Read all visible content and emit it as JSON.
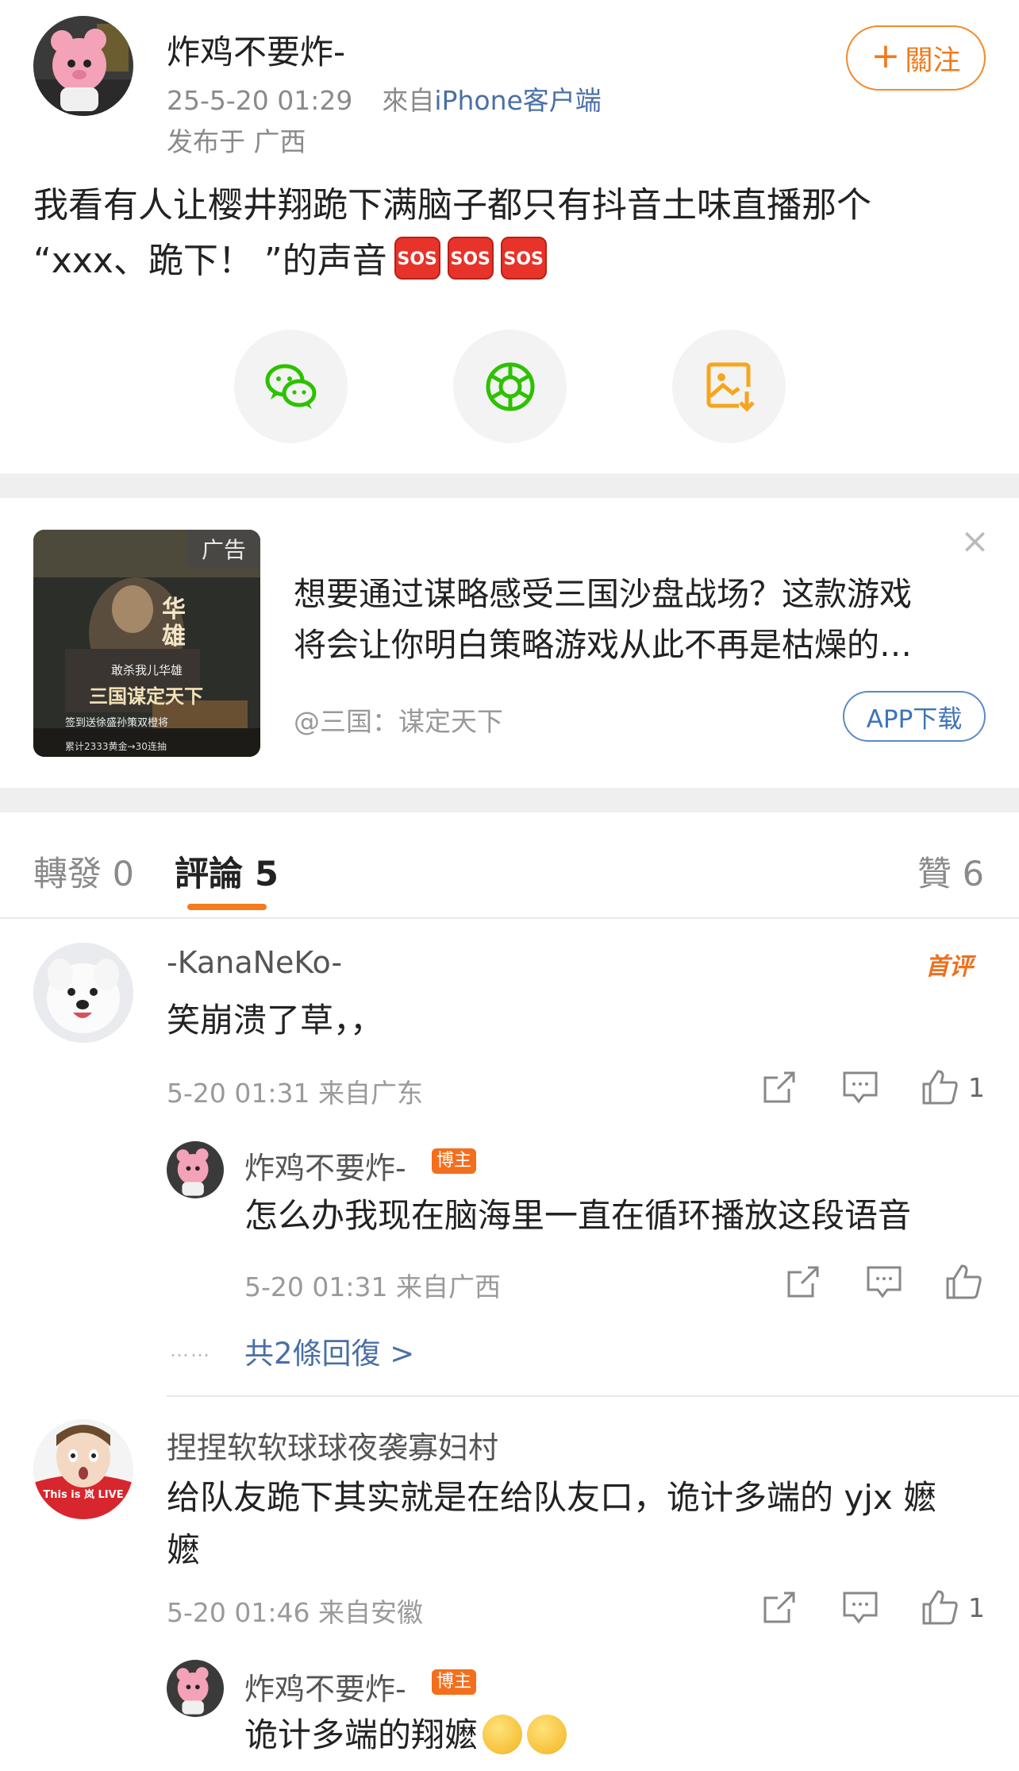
{
  "post": {
    "author": "炸鸡不要炸-",
    "time": "25-5-20 01:29",
    "from_prefix": "來自",
    "source": "iPhone客户端",
    "location": "发布于 广西",
    "follow_label": "關注",
    "text_line1": "我看有人让樱井翔跪下满脑子都只有抖音土味直播那个",
    "text_line2": "“xxx、跪下！ ”的声音",
    "sos_emoji": [
      "SOS",
      "SOS",
      "SOS"
    ],
    "share_icons": [
      "wechat-icon",
      "moments-icon",
      "save-image-icon"
    ]
  },
  "ad": {
    "tag": "广告",
    "text_line1": "想要通过谋略感受三国沙盘战场？这款游戏",
    "text_line2": "将会让你明白策略游戏从此不再是枯燥的…",
    "source": "@三国：谋定天下",
    "button": "APP下载",
    "close": "×",
    "thumb_title": "华雄",
    "thumb_sub": "敢杀我儿华雄",
    "thumb_logo": "三国谋定天下",
    "thumb_line": "签到送徐盛孙策双橙将",
    "thumb_bottom": "累计2333黄金→30连抽"
  },
  "tabs": {
    "repost": "轉發 0",
    "comments_label": "評論",
    "comments_count": "5",
    "likes": "贊 6"
  },
  "comments": [
    {
      "name": "-KanaNeKo-",
      "badge": "首评",
      "text": "笑崩溃了草，，",
      "meta": "5-20 01:31 来自广东",
      "likes": "1",
      "reply": {
        "name": "炸鸡不要炸-",
        "badge": "博主",
        "text": "怎么办我现在脑海里一直在循环播放这段语音",
        "meta": "5-20 01:31 来自广西"
      },
      "more_dots": "……",
      "more_replies": "共2條回復 >"
    },
    {
      "name": "捏捏软软球球夜袭寡妇村",
      "text_line1": "给队友跪下其实就是在给队友口，诡计多端的 yjx 嬷",
      "text_line2": "嬷",
      "meta": "5-20 01:46 来自安徽",
      "likes": "1",
      "avatar_text": "This is 岚 LIVE",
      "reply": {
        "name": "炸鸡不要炸-",
        "badge": "博主",
        "text": "诡计多端的翔嬷"
      }
    }
  ],
  "colors": {
    "accent": "#f57b1c",
    "link": "#4a6fa5",
    "sos": "#e8332a",
    "wechat": "#2dc100",
    "save": "#f7a51d"
  }
}
